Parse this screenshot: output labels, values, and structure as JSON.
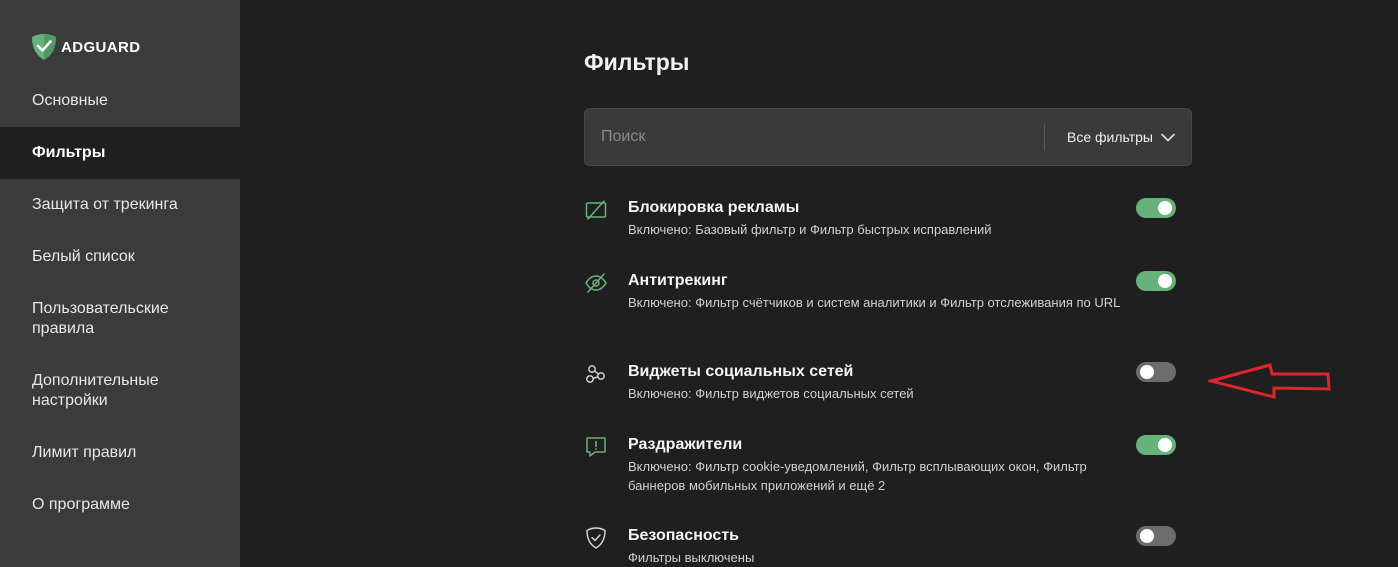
{
  "brand": {
    "name": "ADGUARD",
    "logo_icon": "adguard-shield-check-icon",
    "accent": "#67b279"
  },
  "sidebar": {
    "items": [
      {
        "label": "Основные",
        "active": false
      },
      {
        "label": "Фильтры",
        "active": true
      },
      {
        "label": "Защита от трекинга",
        "active": false
      },
      {
        "label": "Белый список",
        "active": false
      },
      {
        "label": "Пользовательские правила",
        "active": false
      },
      {
        "label": "Дополнительные настройки",
        "active": false
      },
      {
        "label": "Лимит правил",
        "active": false
      },
      {
        "label": "О программе",
        "active": false
      }
    ]
  },
  "main": {
    "title": "Фильтры",
    "search": {
      "placeholder": "Поиск",
      "value": ""
    },
    "filter_select": {
      "value": "Все фильтры",
      "icon": "chevron-down-icon"
    },
    "groups": [
      {
        "title": "Блокировка рекламы",
        "description": "Включено: Базовый фильтр и Фильтр быстрых исправлений",
        "enabled": true,
        "icon": "ad-block-icon"
      },
      {
        "title": "Антитрекинг",
        "description": "Включено: Фильтр счётчиков и систем аналитики и Фильтр отслеживания по URL",
        "enabled": true,
        "icon": "eye-crossed-icon"
      },
      {
        "title": "Виджеты социальных сетей",
        "description": "Включено: Фильтр виджетов социальных сетей",
        "enabled": false,
        "icon": "share-nodes-icon"
      },
      {
        "title": "Раздражители",
        "description": "Включено: Фильтр cookie-уведомлений, Фильтр всплывающих окон, Фильтр баннеров мобильных приложений и ещё 2",
        "enabled": true,
        "icon": "alert-bubble-icon"
      },
      {
        "title": "Безопасность",
        "description": "Фильтры выключены",
        "enabled": false,
        "icon": "shield-check-icon"
      }
    ]
  },
  "annotation": {
    "icon": "red-arrow-left-icon",
    "color": "#e0242c"
  }
}
